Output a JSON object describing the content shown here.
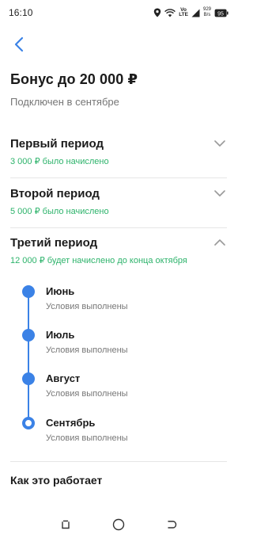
{
  "status_bar": {
    "time": "16:10",
    "network_label_top": "Vo",
    "network_label_bottom": "LTE",
    "speed_value": "929",
    "speed_unit": "B/s",
    "battery_level": "95"
  },
  "header": {
    "title": "Бонус до 20 000 ₽",
    "subtitle": "Подключен в сентябре"
  },
  "periods": [
    {
      "title": "Первый период",
      "note": "3 000 ₽ было начислено",
      "expanded": false
    },
    {
      "title": "Второй период",
      "note": "5 000 ₽ было начислено",
      "expanded": false
    },
    {
      "title": "Третий период",
      "note": "12 000 ₽ будет начислено до конца октября",
      "expanded": true
    }
  ],
  "timeline": [
    {
      "month": "Июнь",
      "status": "Условия выполнены",
      "current": false
    },
    {
      "month": "Июль",
      "status": "Условия выполнены",
      "current": false
    },
    {
      "month": "Август",
      "status": "Условия выполнены",
      "current": false
    },
    {
      "month": "Сентябрь",
      "status": "Условия выполнены",
      "current": true
    }
  ],
  "footer_link": "Как это работает",
  "colors": {
    "accent": "#3b82e6",
    "success": "#2db36b",
    "muted": "#767676"
  },
  "icons": {
    "back": "chevron-left-icon",
    "collapsed": "chevron-down-icon",
    "expanded": "chevron-up-icon",
    "nav_recents": "recents-icon",
    "nav_home": "home-circle-icon",
    "nav_back": "back-nav-icon"
  }
}
